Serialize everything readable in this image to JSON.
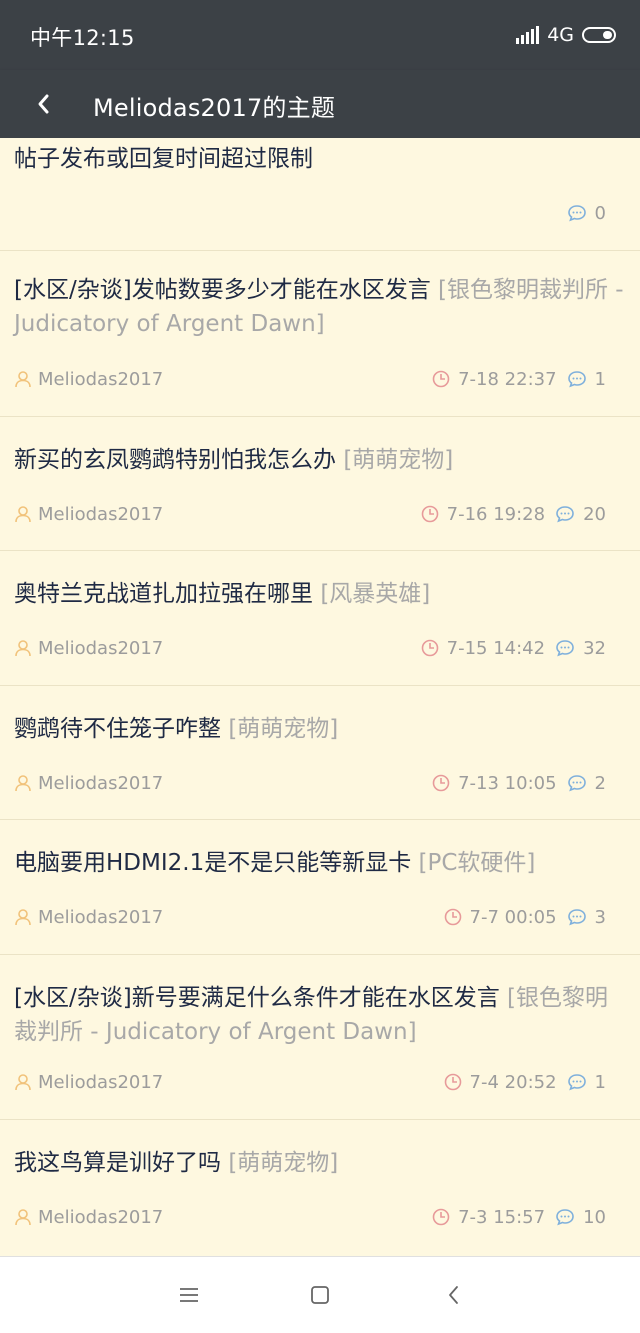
{
  "status_bar": {
    "time": "中午12:15",
    "network": "4G"
  },
  "app_bar": {
    "title": "Meliodas2017的主题"
  },
  "posts": [
    {
      "title": "帖子发布或回复时间超过限制",
      "category": "",
      "author": "",
      "date": "",
      "replies": "0"
    },
    {
      "title": "[水区/杂谈]发帖数要多少才能在水区发言",
      "category": "[银色黎明裁判所 - Judicatory of Argent Dawn]",
      "author": "Meliodas2017",
      "date": "7-18 22:37",
      "replies": "1"
    },
    {
      "title": "新买的玄凤鹦鹉特别怕我怎么办",
      "category": "[萌萌宠物]",
      "author": "Meliodas2017",
      "date": "7-16 19:28",
      "replies": "20"
    },
    {
      "title": "奥特兰克战道扎加拉强在哪里",
      "category": "[风暴英雄]",
      "author": "Meliodas2017",
      "date": "7-15 14:42",
      "replies": "32"
    },
    {
      "title": "鹦鹉待不住笼子咋整",
      "category": "[萌萌宠物]",
      "author": "Meliodas2017",
      "date": "7-13 10:05",
      "replies": "2"
    },
    {
      "title": "电脑要用HDMI2.1是不是只能等新显卡",
      "category": "[PC软硬件]",
      "author": "Meliodas2017",
      "date": "7-7 00:05",
      "replies": "3"
    },
    {
      "title": "[水区/杂谈]新号要满足什么条件才能在水区发言",
      "category": "[银色黎明裁判所 - Judicatory of Argent Dawn]",
      "author": "Meliodas2017",
      "date": "7-4 20:52",
      "replies": "1"
    },
    {
      "title": "我这鸟算是训好了吗",
      "category": "[萌萌宠物]",
      "author": "Meliodas2017",
      "date": "7-3 15:57",
      "replies": "10"
    }
  ],
  "colors": {
    "bar_bg": "#3c4146",
    "list_bg": "#fef8e0",
    "title_text": "#1f2a44",
    "category_text": "#a8a8a8",
    "author_icon": "#f1c27a",
    "clock_icon": "#e79a9a",
    "reply_icon": "#7fb0dc"
  },
  "icons": {
    "back": "chevron-left-icon",
    "author": "user-icon",
    "date": "clock-icon",
    "replies": "comment-icon",
    "nav_menu": "menu-icon",
    "nav_home": "square-icon",
    "nav_back": "chevron-left-icon"
  }
}
